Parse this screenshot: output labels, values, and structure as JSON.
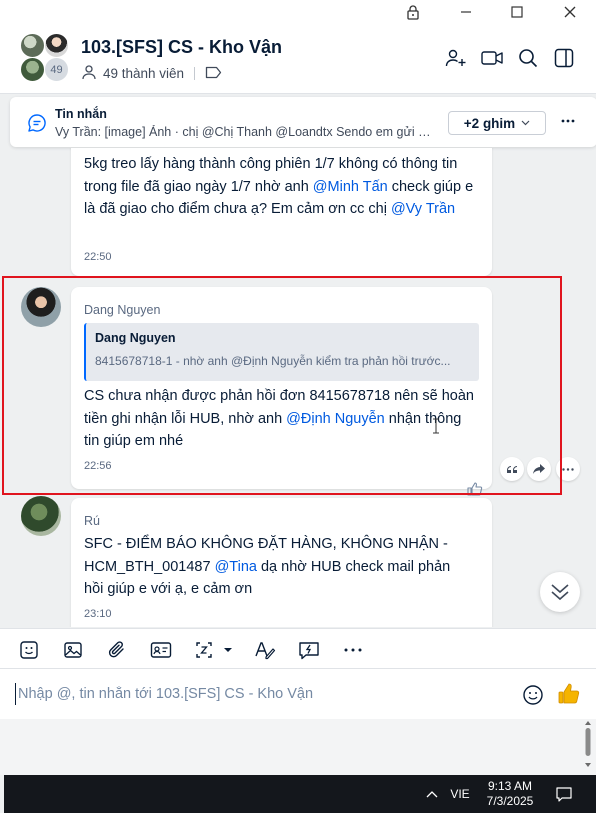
{
  "window": {
    "controls": [
      "lock-icon",
      "minimize-icon",
      "maximize-icon",
      "close-icon"
    ]
  },
  "header": {
    "title": "103.[SFS] CS - Kho Vận",
    "member_count_badge": "49",
    "members_label": "49 thành viên",
    "icons": [
      "add-member-icon",
      "video-call-icon",
      "search-icon",
      "sidebar-toggle-icon"
    ]
  },
  "pinned": {
    "title": "Tin nhắn",
    "preview": "Vy Trần: [image] Ảnh · chị @Chị Thanh @Loandtx Sendo em gửi đầu...",
    "pins_button": "+2 ghim",
    "more": "..."
  },
  "messages": [
    {
      "lines_before": "5kg treo lấy hàng thành công phiên 1/7 không có thông tin trong file đã giao ngày 1/7 nhờ anh ",
      "mention1": "@Minh Tấn",
      "mid": " check giúp e là đã giao cho điểm chưa ạ? Em cảm ơn cc chị ",
      "mention2": "@Vy Trần",
      "time": "22:50"
    },
    {
      "sender": "Dang Nguyen",
      "quote_name": "Dang Nguyen",
      "quote_text": "8415678718-1 - nhờ anh @Định Nguyễn kiểm tra phản hồi trước...",
      "text_before": "CS chưa nhận được phản hồi đơn 8415678718 nên sẽ hoàn tiền ghi nhận lỗi HUB, nhờ anh ",
      "mention": "@Định Nguyễn",
      "text_after": " nhận thông tin giúp em nhé",
      "time": "22:56"
    },
    {
      "sender": "Rú",
      "text_before": "SFC - ĐIỂM BÁO KHÔNG ĐẶT HÀNG, KHÔNG NHẬN - HCM_BTH_001487 ",
      "mention": "@Tina",
      "text_after": " dạ nhờ HUB check mail phản hồi giúp e với ạ, e cảm ơn",
      "time": "23:10"
    }
  ],
  "input": {
    "placeholder": "Nhập @, tin nhắn tới 103.[SFS] CS - Kho Vận"
  },
  "toolbar_icons": [
    "sticker-icon",
    "image-icon",
    "attachment-icon",
    "contact-card-icon",
    "screenshot-icon",
    "format-text-icon",
    "quick-message-icon",
    "more-icon"
  ],
  "taskbar": {
    "language": "VIE",
    "time": "9:13 AM",
    "date": "7/3/2025"
  },
  "colors": {
    "accent": "#005ae0",
    "highlight_box": "#e0141e"
  }
}
